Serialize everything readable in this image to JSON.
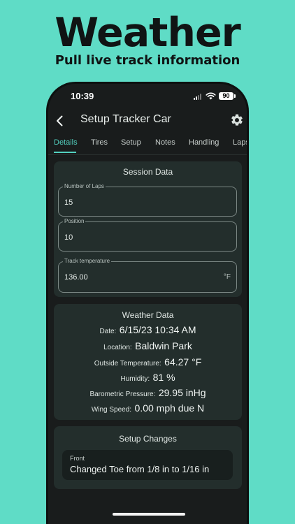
{
  "promo": {
    "headline": "Weather",
    "subhead": "Pull live track information"
  },
  "status_bar": {
    "time": "10:39",
    "battery": "90"
  },
  "app_bar": {
    "title": "Setup Tracker Car",
    "back_icon": "chevron-left-icon",
    "settings_icon": "gear-icon"
  },
  "tabs": [
    {
      "label": "Details",
      "active": true
    },
    {
      "label": "Tires",
      "active": false
    },
    {
      "label": "Setup",
      "active": false
    },
    {
      "label": "Notes",
      "active": false
    },
    {
      "label": "Handling",
      "active": false
    },
    {
      "label": "Laps",
      "active": false
    }
  ],
  "session": {
    "title": "Session Data",
    "laps": {
      "label": "Number of Laps",
      "value": "15"
    },
    "position": {
      "label": "Position",
      "value": "10"
    },
    "track_temp": {
      "label": "Track temperature",
      "value": "136.00",
      "unit": "°F"
    }
  },
  "weather": {
    "title": "Weather Data",
    "rows": [
      {
        "label": "Date:",
        "value": "6/15/23 10:34 AM"
      },
      {
        "label": "Location:",
        "value": "Baldwin Park"
      },
      {
        "label": "Outside Temperature:",
        "value": "64.27 °F"
      },
      {
        "label": "Humidity:",
        "value": "81 %"
      },
      {
        "label": "Barometric Pressure:",
        "value": "29.95 inHg"
      },
      {
        "label": "Wing Speed:",
        "value": "0.00 mph due N"
      }
    ]
  },
  "setup_changes": {
    "title": "Setup Changes",
    "items": [
      {
        "label": "Front",
        "text": "Changed Toe from 1/8 in to 1/16 in"
      }
    ]
  },
  "colors": {
    "background": "#5fdcc6",
    "accent": "#53d1c0",
    "screen": "#191c1c",
    "card": "#232e2c"
  }
}
